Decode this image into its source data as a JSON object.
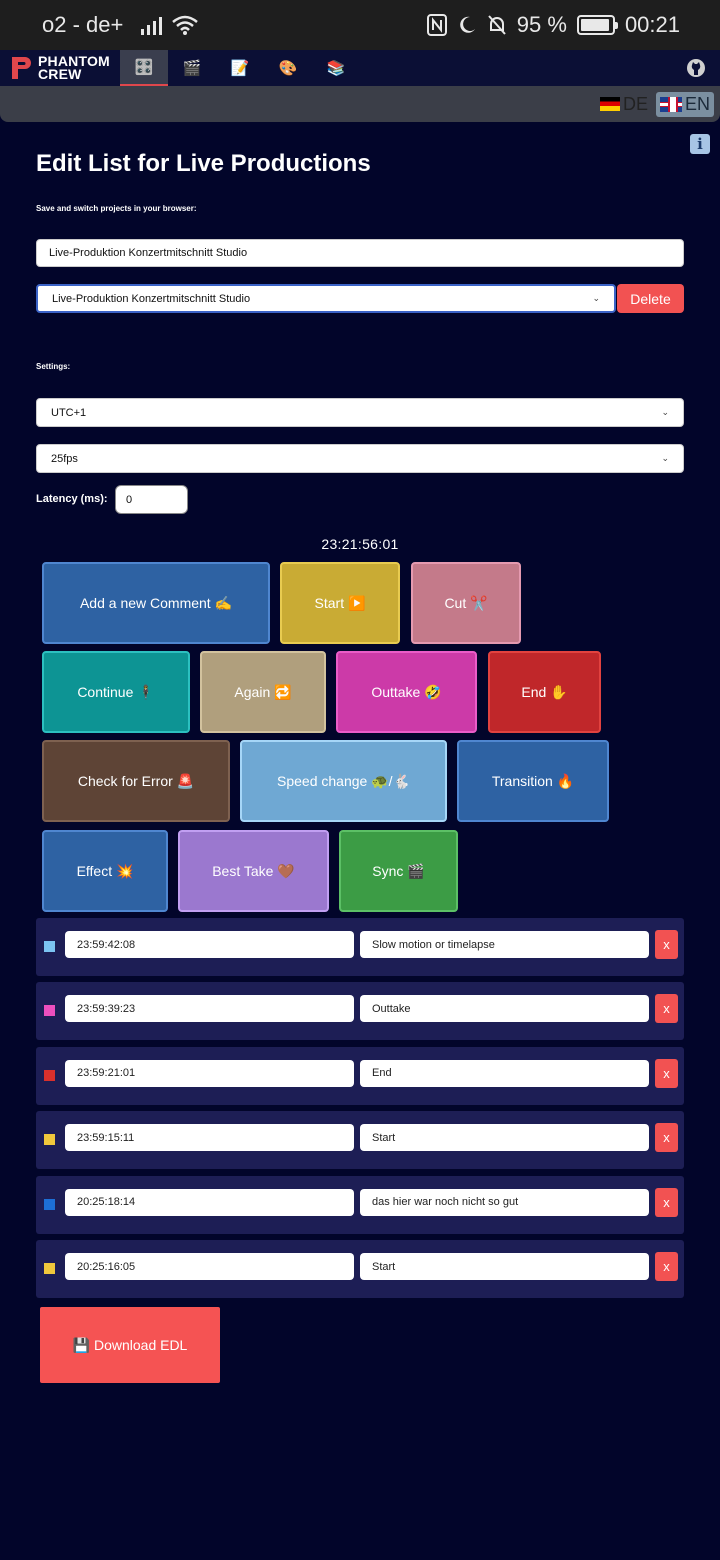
{
  "status_bar": {
    "carrier": "o2 - de+",
    "battery": "95 %",
    "battery_fill": 0.95,
    "time": "00:21"
  },
  "nav": {
    "logo_line1": "PHANTOM",
    "logo_line2": "CREW",
    "tabs": [
      {
        "icon": "🎛️",
        "name": "tab-edl",
        "active": true
      },
      {
        "icon": "🎬",
        "name": "tab-clapper"
      },
      {
        "icon": "📝",
        "name": "tab-notes"
      },
      {
        "icon": "🎨",
        "name": "tab-palette"
      },
      {
        "icon": "📚",
        "name": "tab-books"
      }
    ]
  },
  "lang": {
    "de": "DE",
    "en": "EN",
    "active": "en"
  },
  "page": {
    "title": "Edit List for Live Productions",
    "projects_label": "Save and switch projects in your browser:",
    "project_name_value": "Live-Produktion Konzertmitschnitt Studio",
    "project_select_value": "Live-Produktion Konzertmitschnitt Studio",
    "delete_label": "Delete",
    "settings_label": "Settings:",
    "timezone_value": "UTC+1",
    "fps_value": "25fps",
    "latency_label": "Latency (ms):",
    "latency_value": "0",
    "current_timecode": "23:21:56:01"
  },
  "marker_buttons": [
    {
      "label": "Add a new Comment ✍️",
      "bg": "#2e62a3",
      "border": "#4f86d0"
    },
    {
      "label": "Start ▶️",
      "bg": "#c9ab34",
      "border": "#e8cb50"
    },
    {
      "label": "Cut ✂️",
      "bg": "#c47a8a",
      "border": "#e59ab0"
    },
    {
      "label": "Continue 🕴️",
      "bg": "#0d9494",
      "border": "#2cc0c0"
    },
    {
      "label": "Again 🔁",
      "bg": "#b09f7d",
      "border": "#d2c29e"
    },
    {
      "label": "Outtake 🤣",
      "bg": "#cc3aa8",
      "border": "#ea5cc8"
    },
    {
      "label": "End ✋",
      "bg": "#c0272a",
      "border": "#e2423f"
    },
    {
      "label": "Check for Error 🚨",
      "bg": "#5e4436",
      "border": "#7e6150"
    },
    {
      "label": "Speed change 🐢/🐇",
      "bg": "#6fa8d3",
      "border": "#a6d6f7"
    },
    {
      "label": "Transition 🔥",
      "bg": "#2e62a3",
      "border": "#4f86d0"
    },
    {
      "label": "Effect 💥",
      "bg": "#2e62a3",
      "border": "#4f86d0"
    },
    {
      "label": "Best Take 🤎",
      "bg": "#9b78cf",
      "border": "#c19ff2"
    },
    {
      "label": "Sync 🎬",
      "bg": "#3c9c45",
      "border": "#5cc066"
    }
  ],
  "entries": [
    {
      "timecode": "23:59:42:08",
      "comment": "Slow motion or timelapse",
      "color": "#7cc4f2"
    },
    {
      "timecode": "23:59:39:23",
      "comment": "Outtake",
      "color": "#ec4fbe"
    },
    {
      "timecode": "23:59:21:01",
      "comment": "End",
      "color": "#d9302c"
    },
    {
      "timecode": "23:59:15:11",
      "comment": "Start",
      "color": "#f0c83c"
    },
    {
      "timecode": "20:25:18:14",
      "comment": "das hier war noch nicht so gut",
      "color": "#1d6fd6"
    },
    {
      "timecode": "20:25:16:05",
      "comment": "Start",
      "color": "#f0c83c"
    }
  ],
  "remove_label": "x",
  "download_label": "💾 Download EDL"
}
